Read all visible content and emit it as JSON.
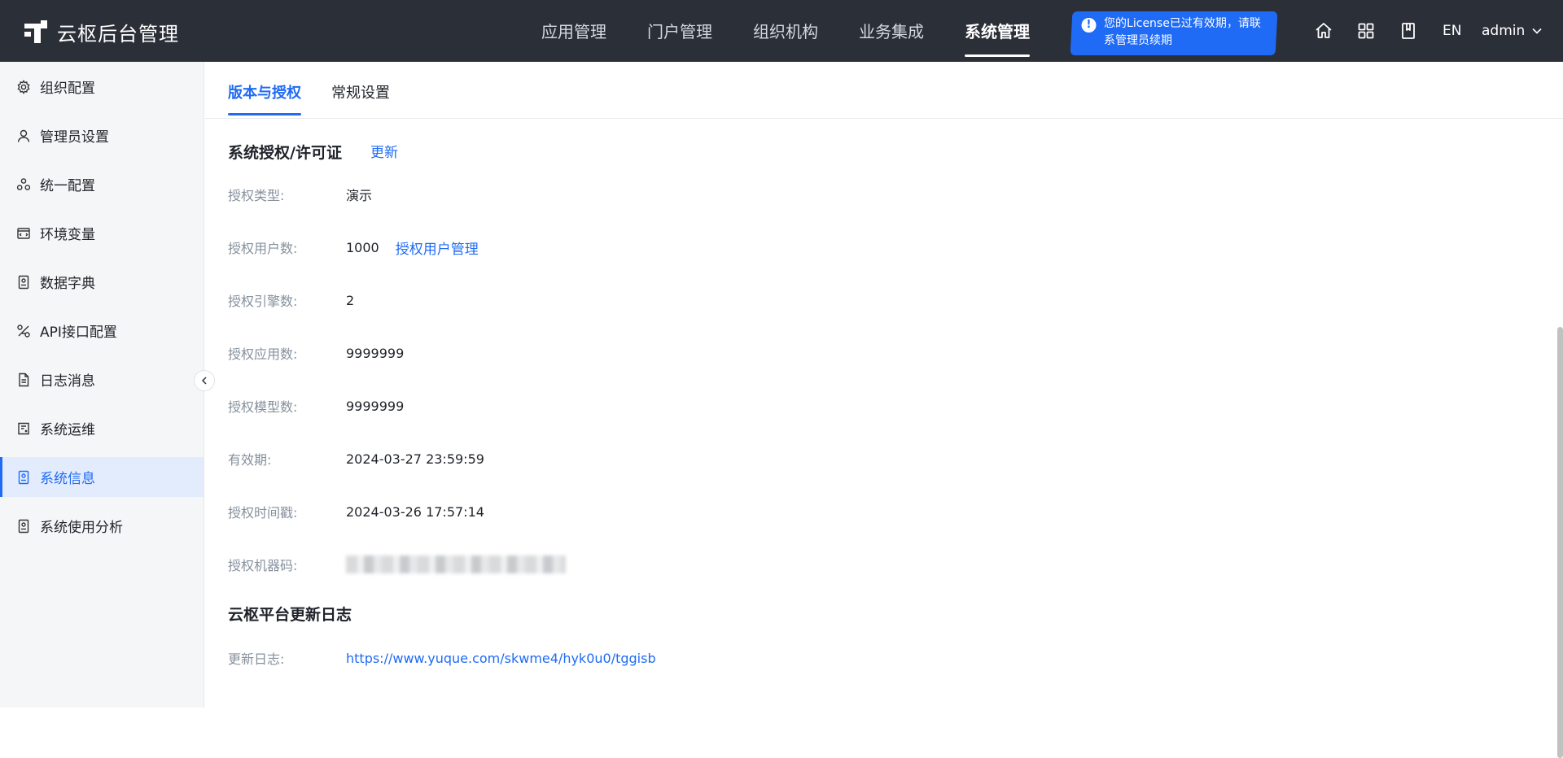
{
  "header": {
    "title": "云枢后台管理",
    "nav": [
      "应用管理",
      "门户管理",
      "组织机构",
      "业务集成",
      "系统管理"
    ],
    "license_tip": "您的License已过有效期，请联系管理员续期",
    "lang": "EN",
    "user": "admin",
    "icons": [
      "home-icon",
      "apps-grid-icon",
      "book-icon"
    ]
  },
  "sidebar": {
    "items": [
      {
        "label": "组织配置",
        "icon": "gear-icon"
      },
      {
        "label": "管理员设置",
        "icon": "user-icon"
      },
      {
        "label": "统一配置",
        "icon": "cluster-icon"
      },
      {
        "label": "环境变量",
        "icon": "code-icon"
      },
      {
        "label": "数据字典",
        "icon": "dictionary-icon"
      },
      {
        "label": "API接口配置",
        "icon": "api-icon"
      },
      {
        "label": "日志消息",
        "icon": "document-icon"
      },
      {
        "label": "系统运维",
        "icon": "maintenance-icon"
      },
      {
        "label": "系统信息",
        "icon": "info-icon"
      },
      {
        "label": "系统使用分析",
        "icon": "analysis-icon"
      }
    ],
    "active": "系统信息"
  },
  "tabs": [
    "版本与授权",
    "常规设置"
  ],
  "license_section": {
    "title": "系统授权/许可证",
    "update_link": "更新",
    "fields": {
      "type": {
        "label": "授权类型:",
        "value": "演示"
      },
      "users": {
        "label": "授权用户数:",
        "value": "1000",
        "link": "授权用户管理"
      },
      "engines": {
        "label": "授权引擎数:",
        "value": "2"
      },
      "apps": {
        "label": "授权应用数:",
        "value": "9999999"
      },
      "models": {
        "label": "授权模型数:",
        "value": "9999999"
      },
      "expiry": {
        "label": "有效期:",
        "value": "2024-03-27 23:59:59"
      },
      "timestamp": {
        "label": "授权时间戳:",
        "value": "2024-03-26 17:57:14"
      },
      "machine_code": {
        "label": "授权机器码:"
      }
    }
  },
  "changelog_section": {
    "title": "云枢平台更新日志",
    "label": "更新日志:",
    "url": "https://www.yuque.com/skwme4/hyk0u0/tggisb"
  },
  "colors": {
    "header_bg": "#2b2f37",
    "accent": "#1f6bf5",
    "sidebar_bg": "#f5f6f8",
    "label_gray": "#86909c"
  }
}
